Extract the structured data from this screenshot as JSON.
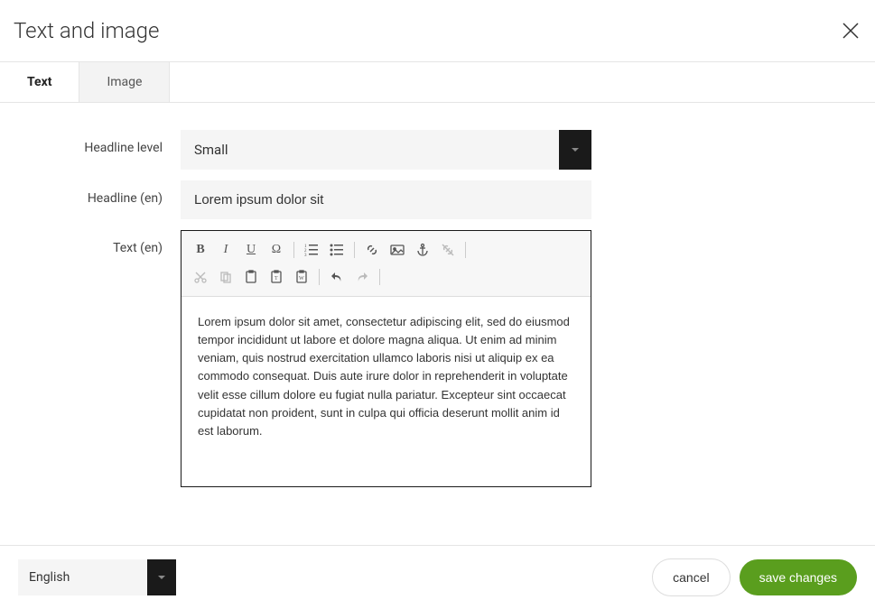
{
  "header": {
    "title": "Text and image"
  },
  "tabs": {
    "text": "Text",
    "image": "Image"
  },
  "form": {
    "headline_level": {
      "label": "Headline level",
      "value": "Small"
    },
    "headline": {
      "label": "Headline (en)",
      "value": "Lorem ipsum dolor sit"
    },
    "text": {
      "label": "Text (en)",
      "value": "Lorem ipsum dolor sit amet, consectetur adipiscing elit, sed do eiusmod tempor incididunt ut labore et dolore magna aliqua. Ut enim ad minim veniam, quis nostrud exercitation ullamco laboris nisi ut aliquip ex ea commodo consequat. Duis aute irure dolor in reprehenderit in voluptate velit esse cillum dolore eu fugiat nulla pariatur. Excepteur sint occaecat cupidatat non proident, sunt in culpa qui officia deserunt mollit anim id est laborum."
    }
  },
  "footer": {
    "language": "English",
    "cancel": "cancel",
    "save": "save changes"
  },
  "colors": {
    "accent_dark": "#1a1a1a",
    "save_green": "#5a9e1e",
    "panel_gray": "#f5f5f5"
  }
}
